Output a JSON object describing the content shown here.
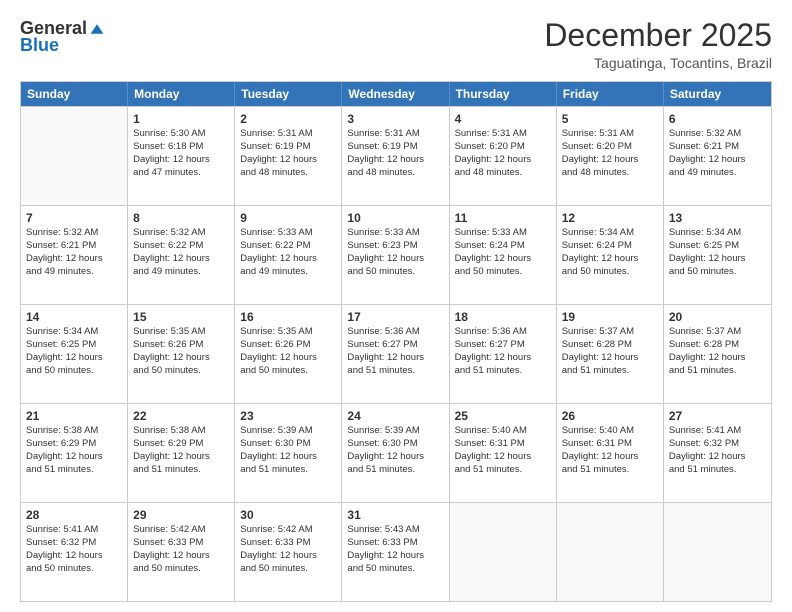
{
  "logo": {
    "general": "General",
    "blue": "Blue"
  },
  "header": {
    "month": "December 2025",
    "location": "Taguatinga, Tocantins, Brazil"
  },
  "weekdays": [
    "Sunday",
    "Monday",
    "Tuesday",
    "Wednesday",
    "Thursday",
    "Friday",
    "Saturday"
  ],
  "weeks": [
    [
      {
        "day": "",
        "lines": [],
        "empty": true
      },
      {
        "day": "1",
        "lines": [
          "Sunrise: 5:30 AM",
          "Sunset: 6:18 PM",
          "Daylight: 12 hours",
          "and 47 minutes."
        ]
      },
      {
        "day": "2",
        "lines": [
          "Sunrise: 5:31 AM",
          "Sunset: 6:19 PM",
          "Daylight: 12 hours",
          "and 48 minutes."
        ]
      },
      {
        "day": "3",
        "lines": [
          "Sunrise: 5:31 AM",
          "Sunset: 6:19 PM",
          "Daylight: 12 hours",
          "and 48 minutes."
        ]
      },
      {
        "day": "4",
        "lines": [
          "Sunrise: 5:31 AM",
          "Sunset: 6:20 PM",
          "Daylight: 12 hours",
          "and 48 minutes."
        ]
      },
      {
        "day": "5",
        "lines": [
          "Sunrise: 5:31 AM",
          "Sunset: 6:20 PM",
          "Daylight: 12 hours",
          "and 48 minutes."
        ]
      },
      {
        "day": "6",
        "lines": [
          "Sunrise: 5:32 AM",
          "Sunset: 6:21 PM",
          "Daylight: 12 hours",
          "and 49 minutes."
        ]
      }
    ],
    [
      {
        "day": "7",
        "lines": [
          "Sunrise: 5:32 AM",
          "Sunset: 6:21 PM",
          "Daylight: 12 hours",
          "and 49 minutes."
        ]
      },
      {
        "day": "8",
        "lines": [
          "Sunrise: 5:32 AM",
          "Sunset: 6:22 PM",
          "Daylight: 12 hours",
          "and 49 minutes."
        ]
      },
      {
        "day": "9",
        "lines": [
          "Sunrise: 5:33 AM",
          "Sunset: 6:22 PM",
          "Daylight: 12 hours",
          "and 49 minutes."
        ]
      },
      {
        "day": "10",
        "lines": [
          "Sunrise: 5:33 AM",
          "Sunset: 6:23 PM",
          "Daylight: 12 hours",
          "and 50 minutes."
        ]
      },
      {
        "day": "11",
        "lines": [
          "Sunrise: 5:33 AM",
          "Sunset: 6:24 PM",
          "Daylight: 12 hours",
          "and 50 minutes."
        ]
      },
      {
        "day": "12",
        "lines": [
          "Sunrise: 5:34 AM",
          "Sunset: 6:24 PM",
          "Daylight: 12 hours",
          "and 50 minutes."
        ]
      },
      {
        "day": "13",
        "lines": [
          "Sunrise: 5:34 AM",
          "Sunset: 6:25 PM",
          "Daylight: 12 hours",
          "and 50 minutes."
        ]
      }
    ],
    [
      {
        "day": "14",
        "lines": [
          "Sunrise: 5:34 AM",
          "Sunset: 6:25 PM",
          "Daylight: 12 hours",
          "and 50 minutes."
        ]
      },
      {
        "day": "15",
        "lines": [
          "Sunrise: 5:35 AM",
          "Sunset: 6:26 PM",
          "Daylight: 12 hours",
          "and 50 minutes."
        ]
      },
      {
        "day": "16",
        "lines": [
          "Sunrise: 5:35 AM",
          "Sunset: 6:26 PM",
          "Daylight: 12 hours",
          "and 50 minutes."
        ]
      },
      {
        "day": "17",
        "lines": [
          "Sunrise: 5:36 AM",
          "Sunset: 6:27 PM",
          "Daylight: 12 hours",
          "and 51 minutes."
        ]
      },
      {
        "day": "18",
        "lines": [
          "Sunrise: 5:36 AM",
          "Sunset: 6:27 PM",
          "Daylight: 12 hours",
          "and 51 minutes."
        ]
      },
      {
        "day": "19",
        "lines": [
          "Sunrise: 5:37 AM",
          "Sunset: 6:28 PM",
          "Daylight: 12 hours",
          "and 51 minutes."
        ]
      },
      {
        "day": "20",
        "lines": [
          "Sunrise: 5:37 AM",
          "Sunset: 6:28 PM",
          "Daylight: 12 hours",
          "and 51 minutes."
        ]
      }
    ],
    [
      {
        "day": "21",
        "lines": [
          "Sunrise: 5:38 AM",
          "Sunset: 6:29 PM",
          "Daylight: 12 hours",
          "and 51 minutes."
        ]
      },
      {
        "day": "22",
        "lines": [
          "Sunrise: 5:38 AM",
          "Sunset: 6:29 PM",
          "Daylight: 12 hours",
          "and 51 minutes."
        ]
      },
      {
        "day": "23",
        "lines": [
          "Sunrise: 5:39 AM",
          "Sunset: 6:30 PM",
          "Daylight: 12 hours",
          "and 51 minutes."
        ]
      },
      {
        "day": "24",
        "lines": [
          "Sunrise: 5:39 AM",
          "Sunset: 6:30 PM",
          "Daylight: 12 hours",
          "and 51 minutes."
        ]
      },
      {
        "day": "25",
        "lines": [
          "Sunrise: 5:40 AM",
          "Sunset: 6:31 PM",
          "Daylight: 12 hours",
          "and 51 minutes."
        ]
      },
      {
        "day": "26",
        "lines": [
          "Sunrise: 5:40 AM",
          "Sunset: 6:31 PM",
          "Daylight: 12 hours",
          "and 51 minutes."
        ]
      },
      {
        "day": "27",
        "lines": [
          "Sunrise: 5:41 AM",
          "Sunset: 6:32 PM",
          "Daylight: 12 hours",
          "and 51 minutes."
        ]
      }
    ],
    [
      {
        "day": "28",
        "lines": [
          "Sunrise: 5:41 AM",
          "Sunset: 6:32 PM",
          "Daylight: 12 hours",
          "and 50 minutes."
        ]
      },
      {
        "day": "29",
        "lines": [
          "Sunrise: 5:42 AM",
          "Sunset: 6:33 PM",
          "Daylight: 12 hours",
          "and 50 minutes."
        ]
      },
      {
        "day": "30",
        "lines": [
          "Sunrise: 5:42 AM",
          "Sunset: 6:33 PM",
          "Daylight: 12 hours",
          "and 50 minutes."
        ]
      },
      {
        "day": "31",
        "lines": [
          "Sunrise: 5:43 AM",
          "Sunset: 6:33 PM",
          "Daylight: 12 hours",
          "and 50 minutes."
        ]
      },
      {
        "day": "",
        "lines": [],
        "empty": true
      },
      {
        "day": "",
        "lines": [],
        "empty": true
      },
      {
        "day": "",
        "lines": [],
        "empty": true
      }
    ]
  ]
}
